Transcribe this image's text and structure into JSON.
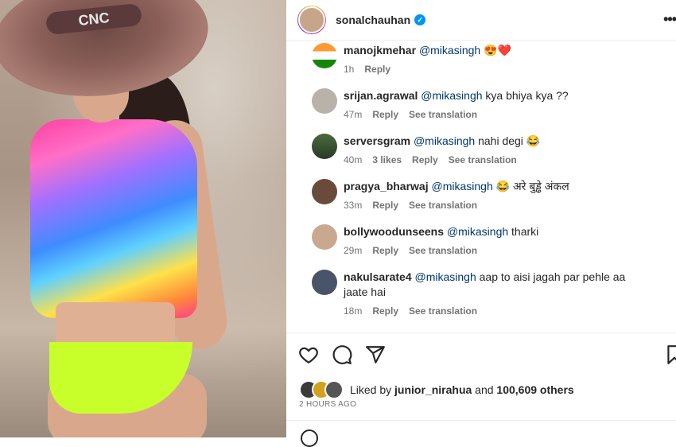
{
  "post": {
    "photo_text": "CNC",
    "username": "sonalchauhan",
    "more_label": "•••"
  },
  "comments": [
    {
      "user": "manojkmehar",
      "mention": "@mikasingh",
      "text": "😍❤️",
      "time": "1h",
      "likes": "",
      "reply": "Reply",
      "translation": ""
    },
    {
      "user": "srijan.agrawal",
      "mention": "@mikasingh",
      "text": "kya bhiya kya ??",
      "time": "47m",
      "likes": "",
      "reply": "Reply",
      "translation": "See translation"
    },
    {
      "user": "serversgram",
      "mention": "@mikasingh",
      "text": "nahi degi 😂",
      "time": "40m",
      "likes": "3 likes",
      "reply": "Reply",
      "translation": "See translation"
    },
    {
      "user": "pragya_bharwaj",
      "mention": "@mikasingh",
      "text": "😂 अरे बुड्ढे अंकल",
      "time": "33m",
      "likes": "",
      "reply": "Reply",
      "translation": "See translation"
    },
    {
      "user": "bollywoodunseens",
      "mention": "@mikasingh",
      "text": "tharki",
      "time": "29m",
      "likes": "",
      "reply": "Reply",
      "translation": "See translation"
    },
    {
      "user": "nakulsarate4",
      "mention": "@mikasingh",
      "text": "aap to aisi jagah par pehle aa jaate hai",
      "time": "18m",
      "likes": "",
      "reply": "Reply",
      "translation": "See translation"
    }
  ],
  "actions": {
    "like_icon": "heart-icon",
    "comment_icon": "comment-icon",
    "share_icon": "send-icon",
    "save_icon": "bookmark-icon"
  },
  "likes": {
    "prefix": "Liked by",
    "user": "junior_nirahua",
    "middle": "and",
    "count": "100,609 others"
  },
  "timestamp": "2 HOURS AGO",
  "colors": {
    "link": "#00376b",
    "verified": "#0095f6",
    "muted": "#737373"
  }
}
